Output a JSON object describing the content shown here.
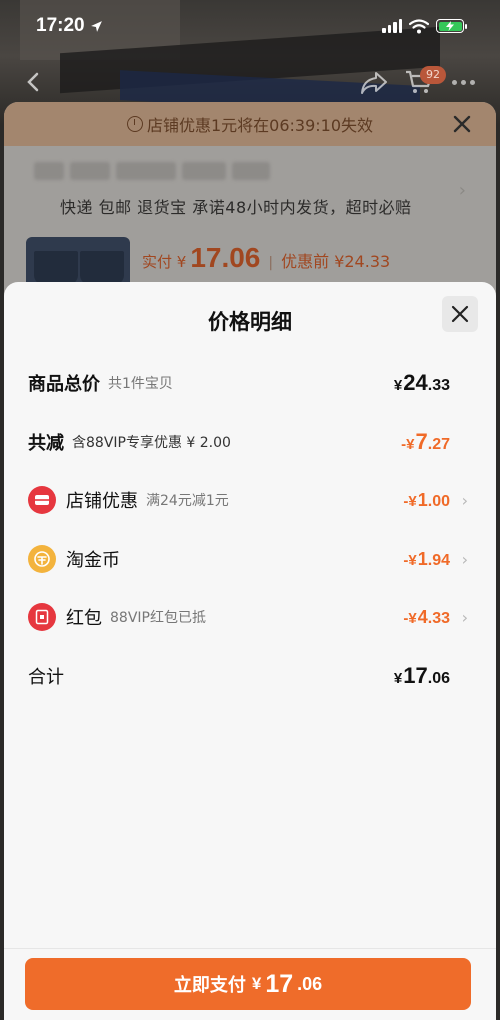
{
  "status_bar": {
    "time": "17:20"
  },
  "nav": {
    "cart_badge": "92"
  },
  "background_card": {
    "banner_text": "店铺优惠1元将在06:39:10失效",
    "shipping_text": "快递 包邮 退货宝 承诺48小时内发货，超时必赔",
    "paid_label": "实付 ¥",
    "paid_amount": "17.06",
    "separator": "|",
    "pre_discount": "优惠前 ¥24.33"
  },
  "sheet": {
    "title": "价格明细",
    "rows": [
      {
        "name": "商品总价",
        "sub": "共1件宝贝",
        "yen": "¥",
        "int": "24",
        "dec": ".33",
        "icon": ""
      },
      {
        "name": "共减",
        "sub": "含88VIP专享优惠 ¥ 2.00",
        "yen": "-¥",
        "int": "7",
        "dec": ".27",
        "icon": ""
      },
      {
        "name": "店铺优惠",
        "sub": "满24元减1元",
        "yen": "-¥",
        "int": "1",
        "dec": ".00",
        "icon": "store-coupon-icon"
      },
      {
        "name": "淘金币",
        "sub": "",
        "yen": "-¥",
        "int": "1",
        "dec": ".94",
        "icon": "gold-coin-icon"
      },
      {
        "name": "红包",
        "sub": "88VIP红包已抵",
        "yen": "-¥",
        "int": "4",
        "dec": ".33",
        "icon": "red-packet-icon"
      },
      {
        "name": "合计",
        "sub": "",
        "yen": "¥",
        "int": "17",
        "dec": ".06",
        "icon": ""
      }
    ],
    "pay_button": {
      "label": "立即支付",
      "yen": "¥",
      "int": "17",
      "dec": ".06"
    }
  },
  "colors": {
    "accent": "#ef6c2a",
    "discount": "#f06a28",
    "sheet_bg": "#f7f7f7"
  }
}
